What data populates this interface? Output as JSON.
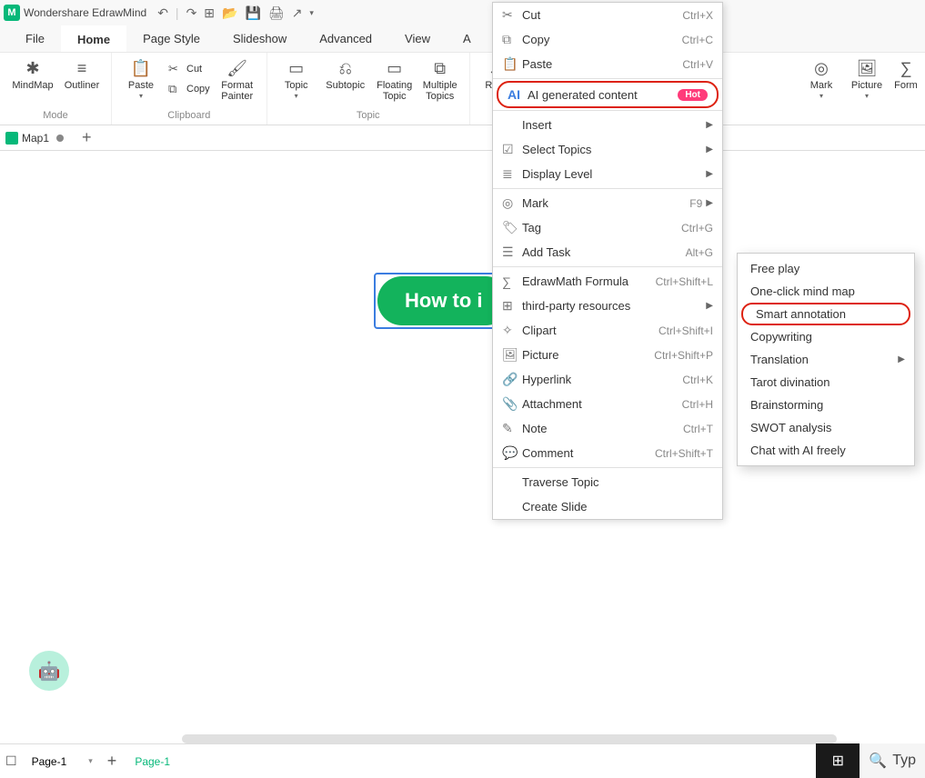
{
  "app": {
    "name": "Wondershare EdrawMind"
  },
  "menu": {
    "file": "File",
    "home": "Home",
    "pageStyle": "Page Style",
    "slideshow": "Slideshow",
    "advanced": "Advanced",
    "view": "View",
    "aPartial": "A"
  },
  "ribbon": {
    "mode": {
      "mindmap": "MindMap",
      "outliner": "Outliner",
      "label": "Mode"
    },
    "clipboard": {
      "paste": "Paste",
      "cut": "Cut",
      "copy": "Copy",
      "formatPainter": "Format\nPainter",
      "label": "Clipboard"
    },
    "topic": {
      "topic": "Topic",
      "subtopic": "Subtopic",
      "floating": "Floating\nTopic",
      "multiple": "Multiple\nTopics",
      "label": "Topic"
    },
    "relation": "Rela",
    "mark": "Mark",
    "picture": "Picture",
    "formula": "Form"
  },
  "tab": {
    "name": "Map1"
  },
  "node": {
    "text": "How to i"
  },
  "contextMenu": [
    {
      "icon": "✂",
      "name": "cut-icon",
      "label": "Cut",
      "shortcut": "Ctrl+X"
    },
    {
      "icon": "⧉",
      "name": "copy-icon",
      "label": "Copy",
      "shortcut": "Ctrl+C"
    },
    {
      "icon": "📋",
      "name": "paste-icon",
      "label": "Paste",
      "shortcut": "Ctrl+V"
    },
    {
      "divider": true
    },
    {
      "ai": true,
      "label": "AI generated content",
      "hot": "Hot",
      "highlighted": true
    },
    {
      "divider": true
    },
    {
      "icon": "",
      "label": "Insert",
      "submenu": true
    },
    {
      "icon": "☑",
      "name": "select-icon",
      "label": "Select Topics",
      "submenu": true
    },
    {
      "icon": "≣",
      "name": "layers-icon",
      "label": "Display Level",
      "submenu": true
    },
    {
      "divider": true
    },
    {
      "icon": "◎",
      "name": "mark-icon",
      "label": "Mark",
      "shortcut": "F9",
      "submenu": true
    },
    {
      "icon": "🏷",
      "name": "tag-icon",
      "label": "Tag",
      "shortcut": "Ctrl+G"
    },
    {
      "icon": "☰",
      "name": "task-icon",
      "label": "Add Task",
      "shortcut": "Alt+G"
    },
    {
      "divider": true
    },
    {
      "icon": "∑",
      "name": "formula-icon",
      "label": "EdrawMath Formula",
      "shortcut": "Ctrl+Shift+L"
    },
    {
      "icon": "⊞",
      "name": "resources-icon",
      "label": "third-party resources",
      "submenu": true
    },
    {
      "icon": "✧",
      "name": "clipart-icon",
      "label": "Clipart",
      "shortcut": "Ctrl+Shift+I"
    },
    {
      "icon": "🖼",
      "name": "picture-icon",
      "label": "Picture",
      "shortcut": "Ctrl+Shift+P"
    },
    {
      "icon": "🔗",
      "name": "link-icon",
      "label": "Hyperlink",
      "shortcut": "Ctrl+K"
    },
    {
      "icon": "📎",
      "name": "attachment-icon",
      "label": "Attachment",
      "shortcut": "Ctrl+H"
    },
    {
      "icon": "✎",
      "name": "note-icon",
      "label": "Note",
      "shortcut": "Ctrl+T"
    },
    {
      "icon": "💬",
      "name": "comment-icon",
      "label": "Comment",
      "shortcut": "Ctrl+Shift+T"
    },
    {
      "divider": true
    },
    {
      "icon": "",
      "label": "Traverse Topic"
    },
    {
      "icon": "",
      "label": "Create Slide"
    }
  ],
  "aiSubmenu": [
    {
      "label": "Free play"
    },
    {
      "label": "One-click mind map"
    },
    {
      "label": "Smart annotation",
      "highlighted": true
    },
    {
      "label": "Copywriting"
    },
    {
      "label": "Translation",
      "submenu": true
    },
    {
      "label": "Tarot divination"
    },
    {
      "label": "Brainstorming"
    },
    {
      "label": "SWOT analysis"
    },
    {
      "label": "Chat with AI freely"
    }
  ],
  "status": {
    "pageSel": "Page-1",
    "pageTab": "Page-1",
    "searchHint": "Typ"
  }
}
